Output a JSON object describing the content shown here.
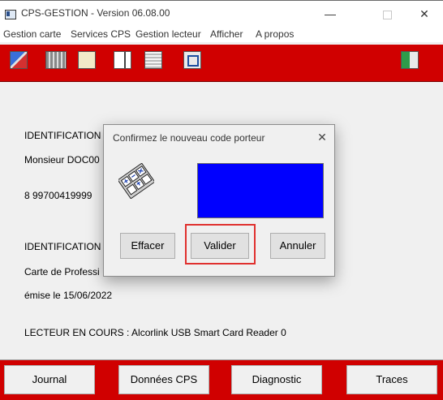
{
  "window": {
    "title": "CPS-GESTION - Version 06.08.00",
    "minimize_glyph": "—",
    "close_glyph": "✕"
  },
  "menu": [
    "Gestion carte",
    "Services CPS",
    "Gestion lecteur",
    "Afficher",
    "A propos"
  ],
  "toolbar": {
    "icons": [
      "card-transfer-icon",
      "card-reader-icon",
      "card-info-icon",
      "card-list-icon",
      "document-icon",
      "network-icon",
      "exit-icon"
    ]
  },
  "main": {
    "lines": [
      "IDENTIFICATION",
      "Monsieur DOC00",
      "8 99700419999",
      "IDENTIFICATION",
      "Carte de Professi",
      "émise le 15/06/2022",
      "LECTEUR EN COURS : Alcorlink USB Smart Card Reader 0"
    ]
  },
  "dialog": {
    "title": "Confirmez le nouveau code porteur",
    "close_glyph": "✕",
    "display_color": "#0000ff",
    "buttons": {
      "clear": "Effacer",
      "validate": "Valider",
      "cancel": "Annuler"
    },
    "highlight_color": "#e0302e"
  },
  "bottom": {
    "buttons": [
      "Journal",
      "Données CPS",
      "Diagnostic",
      "Traces"
    ]
  },
  "colors": {
    "accent_red": "#d00000",
    "display_blue": "#0000ff"
  }
}
